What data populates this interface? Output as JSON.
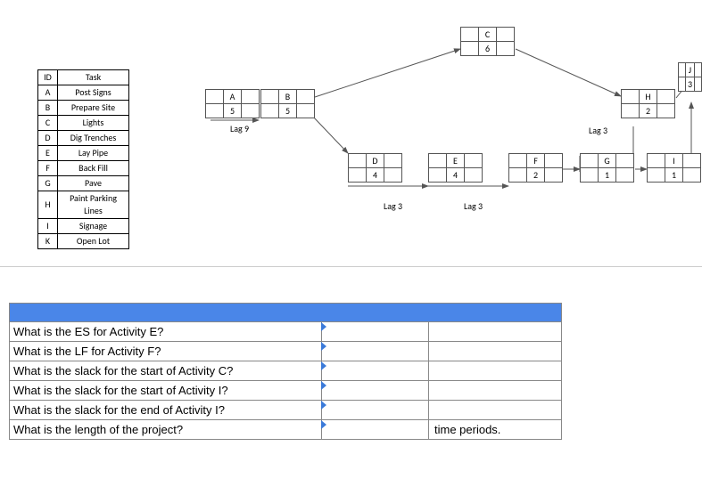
{
  "task_table": {
    "header_id": "ID",
    "header_task": "Task",
    "rows": [
      {
        "id": "A",
        "task": "Post Signs"
      },
      {
        "id": "B",
        "task": "Prepare Site"
      },
      {
        "id": "C",
        "task": "Lights"
      },
      {
        "id": "D",
        "task": "Dig Trenches"
      },
      {
        "id": "E",
        "task": "Lay Pipe"
      },
      {
        "id": "F",
        "task": "Back Fill"
      },
      {
        "id": "G",
        "task": "Pave"
      },
      {
        "id": "H",
        "task": "Paint Parking Lines"
      },
      {
        "id": "I",
        "task": "Signage"
      },
      {
        "id": "K",
        "task": "Open Lot"
      }
    ]
  },
  "nodes": {
    "A": {
      "id": "A",
      "cells": {
        "tl": "",
        "tc": "A",
        "tr": "",
        "bl": "",
        "bc": "5",
        "br": ""
      }
    },
    "B": {
      "id": "B",
      "cells": {
        "tl": "",
        "tc": "B",
        "tr": "",
        "bl": "",
        "bc": "5",
        "br": ""
      }
    },
    "C": {
      "id": "C",
      "cells": {
        "tl": "",
        "tc": "C",
        "tr": "",
        "bl": "",
        "bc": "6",
        "br": ""
      }
    },
    "D": {
      "id": "D",
      "cells": {
        "tl": "",
        "tc": "D",
        "tr": "",
        "bl": "",
        "bc": "4",
        "br": ""
      }
    },
    "E": {
      "id": "E",
      "cells": {
        "tl": "",
        "tc": "E",
        "tr": "",
        "bl": "",
        "bc": "4",
        "br": ""
      }
    },
    "F": {
      "id": "F",
      "cells": {
        "tl": "",
        "tc": "F",
        "tr": "",
        "bl": "",
        "bc": "2",
        "br": ""
      }
    },
    "G": {
      "id": "G",
      "cells": {
        "tl": "",
        "tc": "G",
        "tr": "",
        "bl": "",
        "bc": "1",
        "br": ""
      }
    },
    "H": {
      "id": "H",
      "cells": {
        "tl": "",
        "tc": "H",
        "tr": "",
        "bl": "",
        "bc": "2",
        "br": ""
      }
    },
    "I": {
      "id": "I",
      "cells": {
        "tl": "",
        "tc": "I",
        "tr": "",
        "bl": "",
        "bc": "1",
        "br": ""
      }
    },
    "J": {
      "id": "J",
      "cells": {
        "tl": "",
        "tc": "J",
        "tr": "",
        "bl": "",
        "bc": "3",
        "br": ""
      }
    }
  },
  "lags": {
    "AB": "Lag 9",
    "GH": "Lag  3",
    "DE": "Lag 3",
    "EF": "Lag 3"
  },
  "questions": [
    {
      "text": "What is the ES for Activity E?",
      "unit": ""
    },
    {
      "text": "What is the LF for Activity F?",
      "unit": ""
    },
    {
      "text": "What is the slack for the start of Activity C?",
      "unit": ""
    },
    {
      "text": "What is the slack for the start of Activity I?",
      "unit": ""
    },
    {
      "text": "What is the slack for the end of Activity I?",
      "unit": ""
    },
    {
      "text": "What is the length of the project?",
      "unit": "time periods."
    }
  ]
}
